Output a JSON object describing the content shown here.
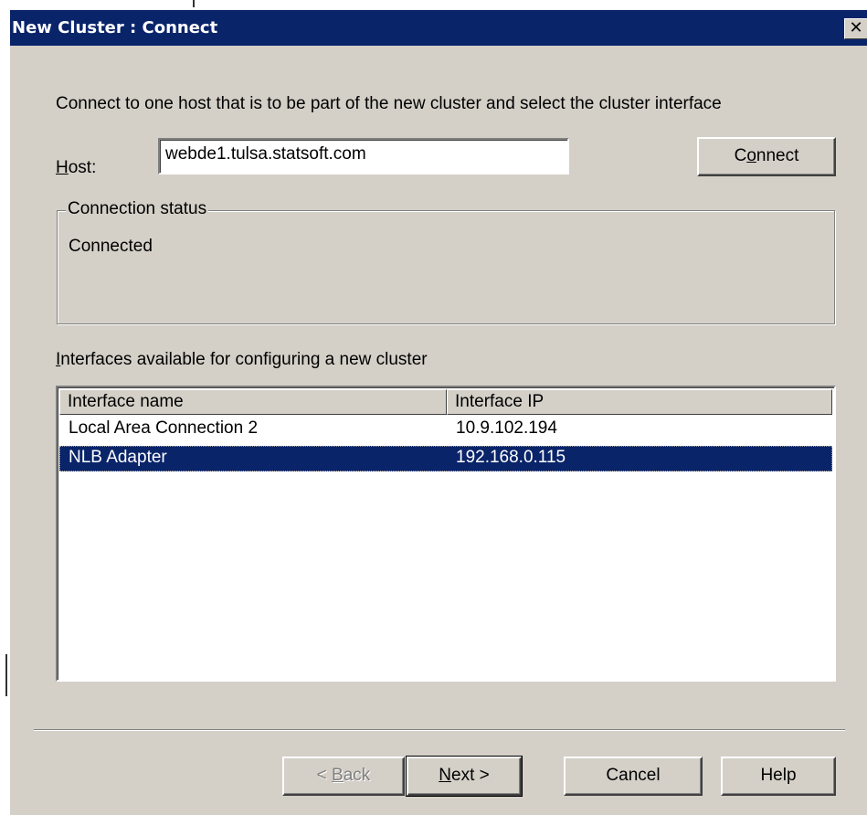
{
  "window": {
    "title": "New Cluster : Connect",
    "close_glyph": "✕"
  },
  "instructions": "Connect to one host that is to be part of the new cluster and select the cluster interface",
  "host": {
    "label_mnemonic": "H",
    "label_rest": "ost:",
    "value": "webde1.tulsa.statsoft.com"
  },
  "connect_button": {
    "pre": "C",
    "mnemonic": "o",
    "post": "nnect"
  },
  "connection_status": {
    "legend": "Connection status",
    "text": "Connected"
  },
  "interfaces": {
    "label_mnemonic": "I",
    "label_rest": "nterfaces available for configuring a new cluster",
    "columns": [
      "Interface name",
      "Interface IP"
    ],
    "rows": [
      {
        "name": "Local Area Connection 2",
        "ip": "10.9.102.194",
        "selected": false
      },
      {
        "name": "NLB Adapter",
        "ip": "192.168.0.115",
        "selected": true
      }
    ]
  },
  "buttons": {
    "back": {
      "pre": "< ",
      "mnemonic": "B",
      "post": "ack"
    },
    "next": {
      "mnemonic": "N",
      "post": "ext >"
    },
    "cancel": "Cancel",
    "help": "Help"
  },
  "colors": {
    "titlebar": "#0a246a",
    "dialog_bg": "#d4d0c8",
    "selection": "#0a246a"
  }
}
